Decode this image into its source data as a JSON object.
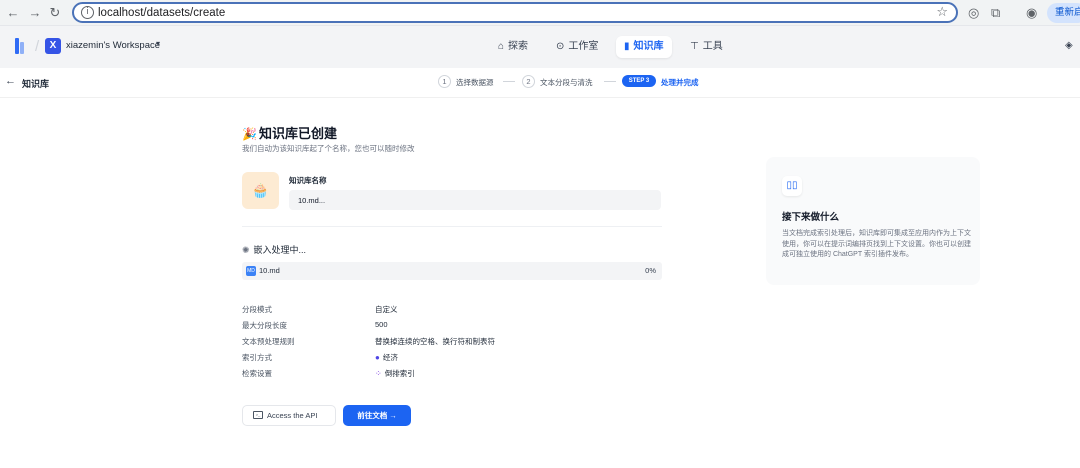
{
  "browser": {
    "url": "localhost/datasets/create",
    "restart_label": "重新启"
  },
  "header": {
    "workspace_initial": "X",
    "workspace_name": "xiazemin's Workspace",
    "nav": [
      {
        "label": "探索",
        "icon": "compass-icon"
      },
      {
        "label": "工作室",
        "icon": "robot-icon"
      },
      {
        "label": "知识库",
        "icon": "book-icon",
        "active": true
      },
      {
        "label": "工具",
        "icon": "tool-icon"
      }
    ]
  },
  "subheader": {
    "back_label": "知识库",
    "steps": [
      {
        "num": "1",
        "label": "选择数据源"
      },
      {
        "num": "2",
        "label": "文本分段与清洗"
      },
      {
        "num": "STEP 3",
        "label": "处理并完成",
        "active": true
      }
    ]
  },
  "main": {
    "title": "知识库已创建",
    "subtitle": "我们自动为该知识库起了个名称，您也可以随时修改",
    "kb_name_label": "知识库名称",
    "kb_name_value": "10.md...",
    "embed_status": "嵌入处理中...",
    "file": {
      "name": "10.md",
      "progress": "0%"
    },
    "settings": [
      {
        "label": "分段模式",
        "value": "自定义"
      },
      {
        "label": "最大分段长度",
        "value": "500"
      },
      {
        "label": "文本预处理规则",
        "value": "替换掉连续的空格、换行符和制表符"
      },
      {
        "label": "索引方式",
        "value": "经济",
        "icon": "piggy-bank-icon"
      },
      {
        "label": "检索设置",
        "value": "倒排索引",
        "icon": "grid-icon"
      }
    ],
    "api_button": "Access the API",
    "doc_button": "前往文档"
  },
  "side": {
    "title": "接下来做什么",
    "body": "当文档完成索引处理后，知识库即可集成至应用内作为上下文使用，你可以在提示词编排页找到上下文设置。你也可以创建成可独立使用的 ChatGPT 索引插件发布。"
  },
  "colors": {
    "accent": "#1c64f2",
    "header_bg": "#f3f4f6",
    "kb_icon_bg": "#fdebd3"
  }
}
